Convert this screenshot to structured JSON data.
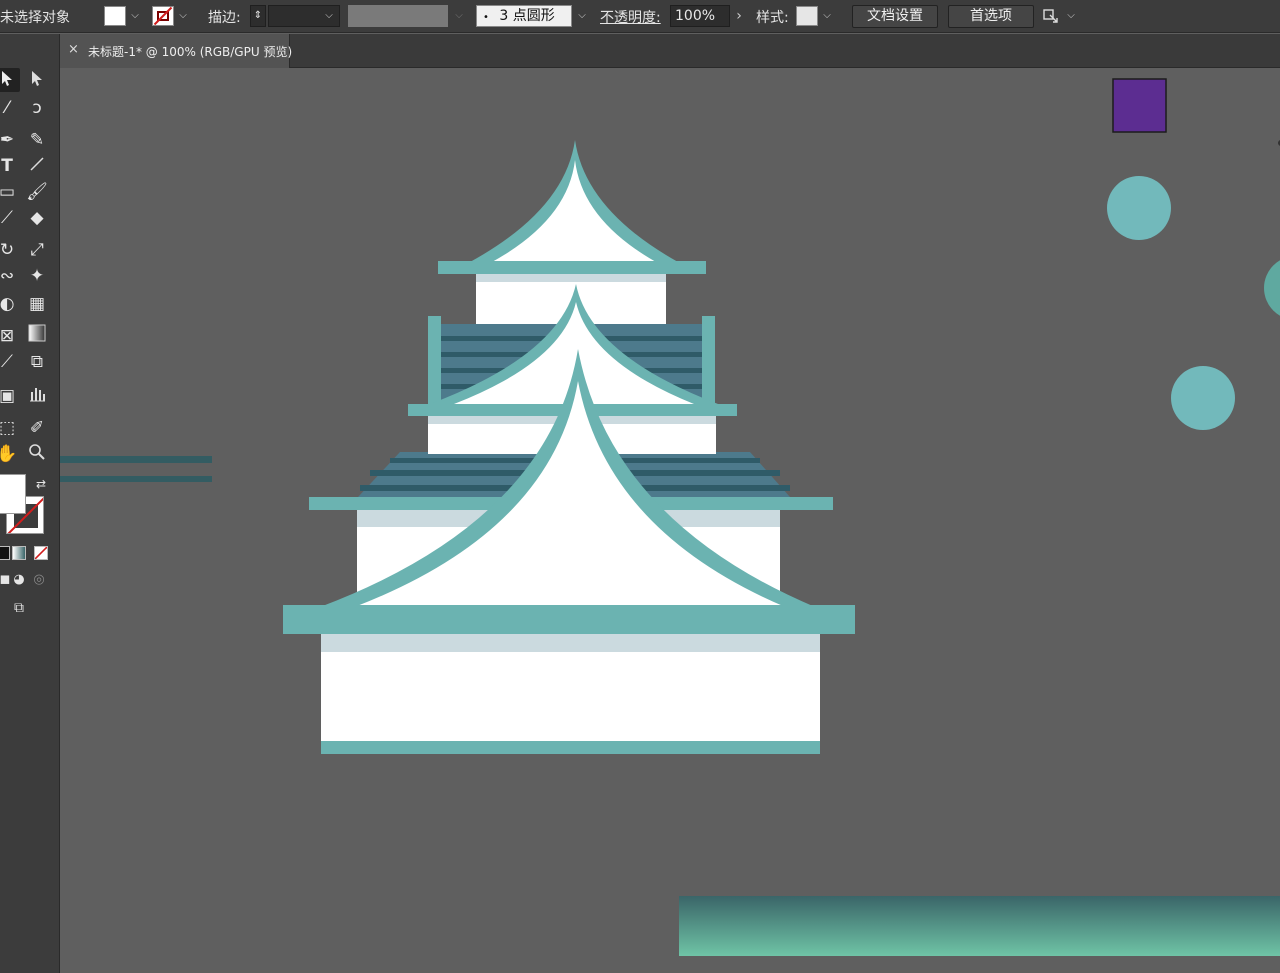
{
  "control_bar": {
    "selection_status": "未选择对象",
    "stroke_label": "描边:",
    "brush_value": "3 点圆形",
    "opacity_label": "不透明度:",
    "opacity_value": "100%",
    "style_label": "样式:",
    "doc_settings_button": "文档设置",
    "preferences_button": "首选项"
  },
  "document_tab": {
    "close_glyph": "×",
    "title": "未标题-1* @ 100% (RGB/GPU 预览)"
  },
  "toolbar": {
    "tools": [
      "selection-tool",
      "direct-selection-tool",
      "magic-wand-tool",
      "lasso-tool",
      "pen-tool",
      "curvature-tool",
      "type-tool",
      "line-segment-tool",
      "rectangle-tool",
      "paintbrush-tool",
      "shaper-tool",
      "eraser-tool",
      "rotate-tool",
      "scale-tool",
      "warp-tool",
      "puppet-warp-tool",
      "shape-builder-tool",
      "perspective-grid-tool",
      "mesh-tool",
      "gradient-tool",
      "eyedropper-tool",
      "blend-tool",
      "symbol-sprayer-tool",
      "column-graph-tool",
      "artboard-tool",
      "slice-tool",
      "hand-tool",
      "zoom-tool"
    ]
  },
  "colors": {
    "canvas_bg": "#5f5f5f",
    "teal_roof": "#6bb3b1",
    "white_wall": "#ffffff",
    "light_band": "#cbdadf",
    "tile_blue": "#4d7a8c",
    "tile_dark": "#2f5b68",
    "purple_swatch": "#5c2d91",
    "circle_teal": "#72b9bb",
    "gradient_top": "#3a6568",
    "gradient_bottom": "#6fc4a6"
  }
}
